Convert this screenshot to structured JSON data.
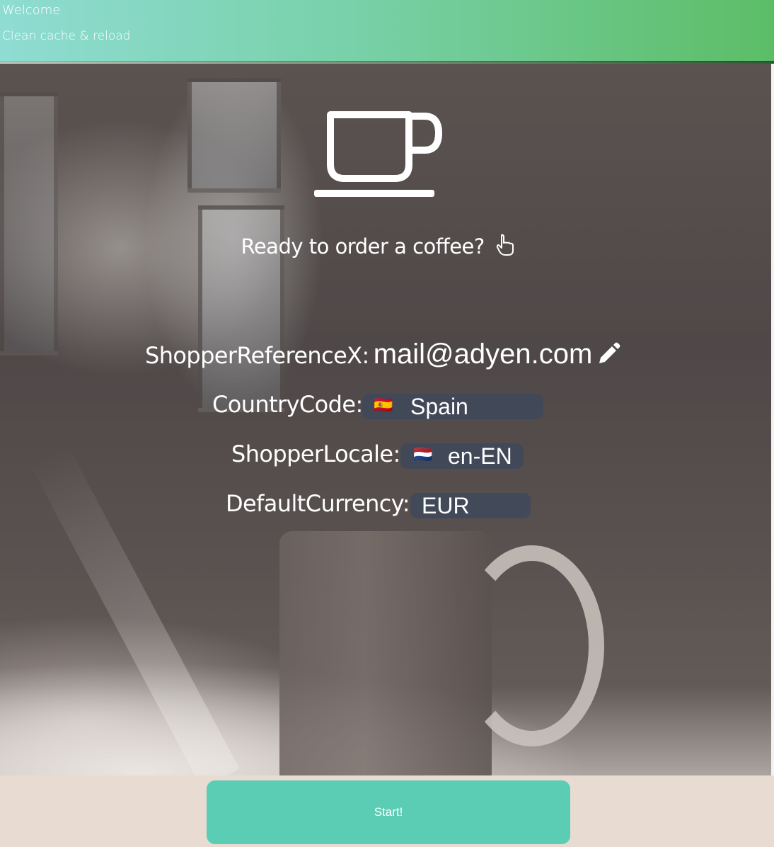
{
  "header": {
    "title": "Welcome",
    "reload_label": "Clean cache & reload"
  },
  "hero": {
    "prompt": "Ready to order a coffee?",
    "prompt_icon": "pointing-hand-icon",
    "main_icon": "coffee-cup-icon"
  },
  "settings": {
    "shopper_reference": {
      "label": "ShopperReferenceX:",
      "value": "mail@adyen.com",
      "edit_icon": "pencil-icon"
    },
    "country_code": {
      "label": "CountryCode:",
      "value": "Spain",
      "flag": "🇪🇸"
    },
    "shopper_locale": {
      "label": "ShopperLocale:",
      "value": "en-EN",
      "flag": "🇳🇱"
    },
    "default_currency": {
      "label": "DefaultCurrency:",
      "value": "EUR"
    }
  },
  "footer": {
    "start_label": "Start!"
  },
  "colors": {
    "header_gradient_start": "#8fdcd3",
    "header_gradient_end": "#5cbd66",
    "start_button": "#5bcdb4",
    "pill_background": "#3c485c",
    "footer_background": "#e8dcd2"
  }
}
